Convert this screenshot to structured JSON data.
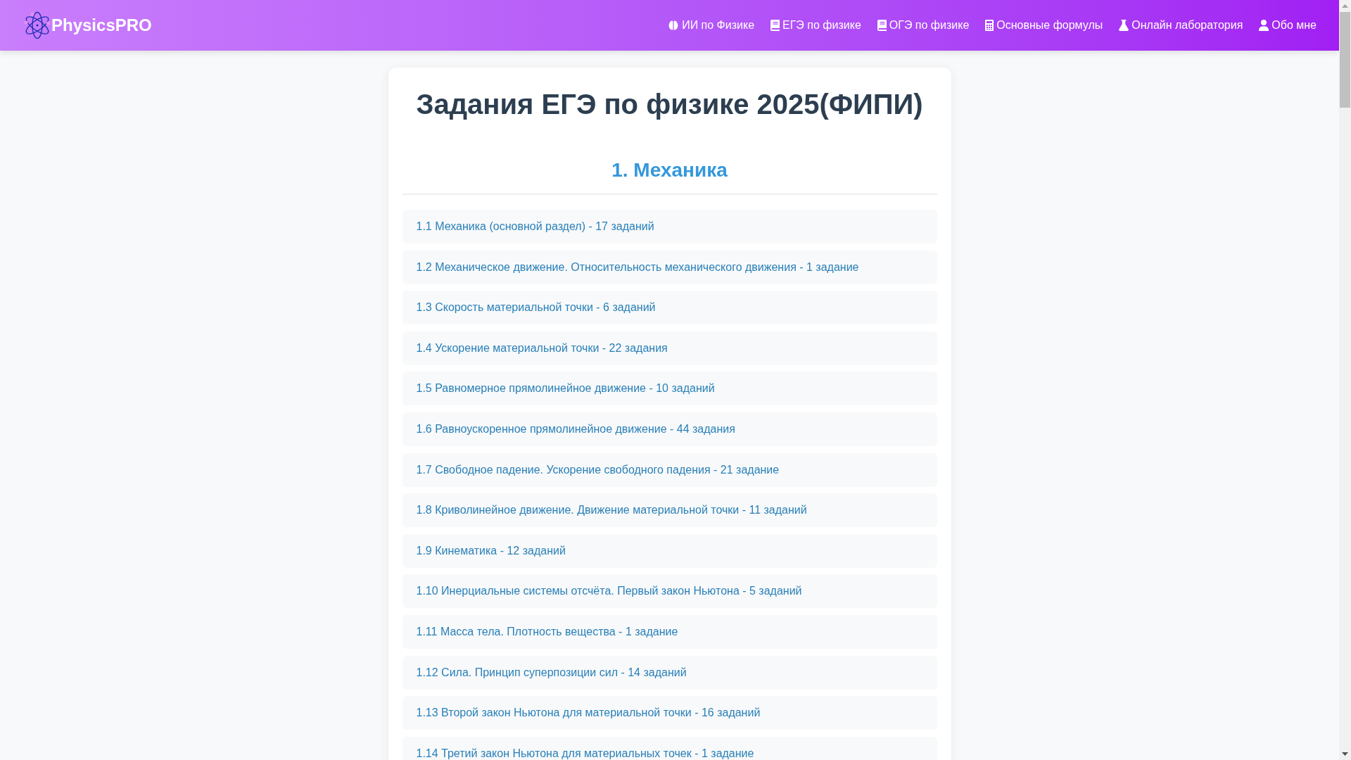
{
  "header": {
    "logo": "PhysicsPRO",
    "nav": [
      "ИИ по Физике",
      "ЕГЭ по физике",
      "ОГЭ по физике",
      "Основные формулы",
      "Онлайн лаборатория",
      "Обо мне"
    ]
  },
  "page_title": "Задания ЕГЭ по физике 2025(ФИПИ)",
  "sections": [
    {
      "heading": "1. Механика",
      "topics": [
        "1.1 Механика (основной раздел) - 17 заданий",
        "1.2 Механическое движение. Относительность механического движения - 1 задание",
        "1.3 Скорость материальной точки - 6 заданий",
        "1.4 Ускорение материальной точки - 22 задания",
        "1.5 Равномерное прямолинейное движение - 10 заданий",
        "1.6 Равноускоренное прямолинейное движение - 44 задания",
        "1.7 Свободное падение. Ускорение свободного падения - 21 задание",
        "1.8 Криволинейное движение. Движение материальной точки - 11 заданий",
        "1.9 Кинематика - 12 заданий",
        "1.10 Инерциальные системы отсчёта. Первый закон Ньютона - 5 заданий",
        "1.11 Масса тела. Плотность вещества - 1 задание",
        "1.12 Сила. Принцип суперпозиции сил - 14 заданий",
        "1.13 Второй закон Ньютона для материальной точки - 16 заданий",
        "1.14 Третий закон Ньютона для материальных точек - 1 задание"
      ]
    }
  ]
}
